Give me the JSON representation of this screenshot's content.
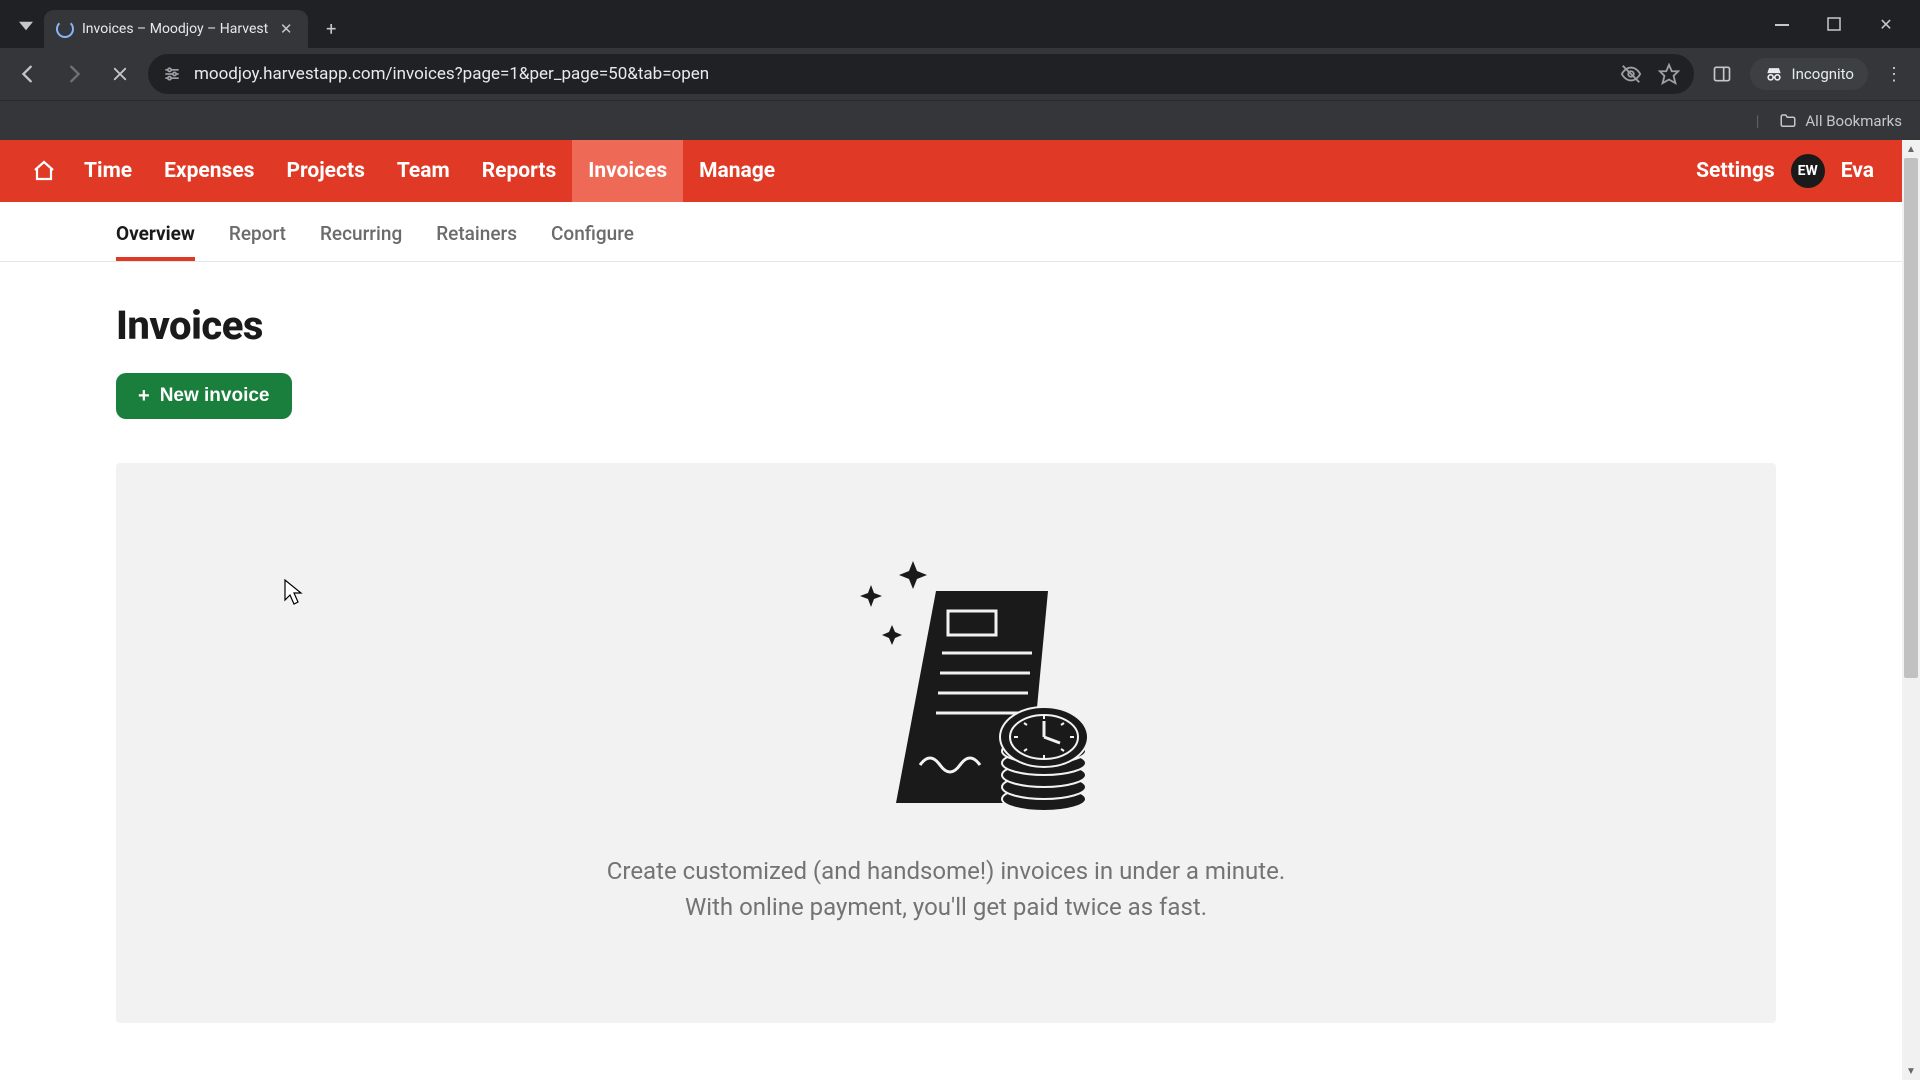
{
  "browser": {
    "tab_title": "Invoices – Moodjoy – Harvest",
    "url": "moodjoy.harvestapp.com/invoices?page=1&per_page=50&tab=open",
    "incognito_label": "Incognito",
    "all_bookmarks": "All Bookmarks"
  },
  "nav": {
    "items": [
      "Time",
      "Expenses",
      "Projects",
      "Team",
      "Reports",
      "Invoices",
      "Manage"
    ],
    "active_index": 5,
    "settings": "Settings",
    "avatar_initials": "EW",
    "user_name": "Eva"
  },
  "subnav": {
    "items": [
      "Overview",
      "Report",
      "Recurring",
      "Retainers",
      "Configure"
    ],
    "active_index": 0
  },
  "page": {
    "title": "Invoices",
    "new_button": "New invoice",
    "empty_line1": "Create customized (and handsome!) invoices in under a minute.",
    "empty_line2": "With online payment, you'll get paid twice as fast."
  }
}
